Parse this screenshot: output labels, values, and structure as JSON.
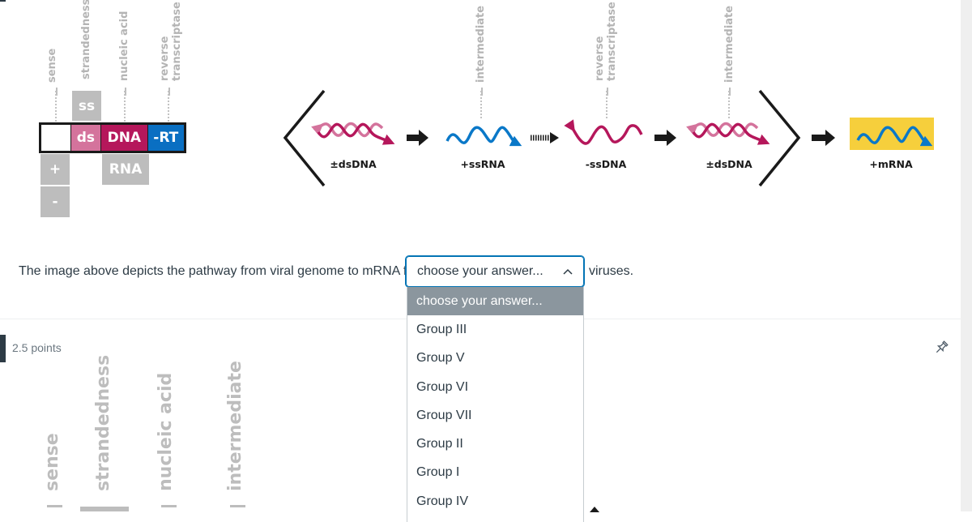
{
  "diagram": {
    "class_axis_labels": {
      "sense": "sense",
      "strandedness": "strandedness",
      "nucleic_acid": "nucleic acid",
      "reverse_transcriptase_1": "reverse",
      "reverse_transcriptase_2": "transcriptase"
    },
    "classification": {
      "strandedness_alt": "ss",
      "strandedness_selected": "ds",
      "nucleic_acid_selected": "DNA",
      "nucleic_acid_alt": "RNA",
      "rt_selected": "-RT",
      "sense_plus": "+",
      "sense_minus": "-"
    },
    "pathway_axis_labels": {
      "intermediate_1": "intermediate",
      "reverse_transcriptase_1": "reverse",
      "reverse_transcriptase_2": "transcriptase",
      "intermediate_2": "intermediate"
    },
    "steps": [
      {
        "label": "±dsDNA",
        "icon": "double-helix-icon"
      },
      {
        "label": "+ssRNA",
        "icon": "single-strand-wave-icon"
      },
      {
        "label": "-ssDNA",
        "icon": "single-strand-wave-icon"
      },
      {
        "label": "±dsDNA",
        "icon": "double-helix-icon"
      },
      {
        "label": "+mRNA",
        "icon": "single-strand-wave-icon"
      }
    ],
    "colors": {
      "dna_dark": "#b5175b",
      "dna_light": "#d4739c",
      "rna_blue": "#0a78c8",
      "rt_blue": "#0a6fc2",
      "mrna_highlight": "#f6cf3c",
      "neutral_gray": "#bdbdbd"
    }
  },
  "question": {
    "prefix": "The image above depicts the pathway from viral genome to mRNA for",
    "suffix": "viruses.",
    "select": {
      "value": "choose your answer...",
      "expanded": true,
      "options": [
        "choose your answer...",
        "Group III",
        "Group V",
        "Group VI",
        "Group VII",
        "Group II",
        "Group I",
        "Group IV"
      ]
    }
  },
  "next_question": {
    "points": "2.5 points",
    "axis_labels": {
      "sense": "sense",
      "strandedness": "strandedness",
      "nucleic_acid": "nucleic acid",
      "intermediate": "intermediate"
    }
  }
}
